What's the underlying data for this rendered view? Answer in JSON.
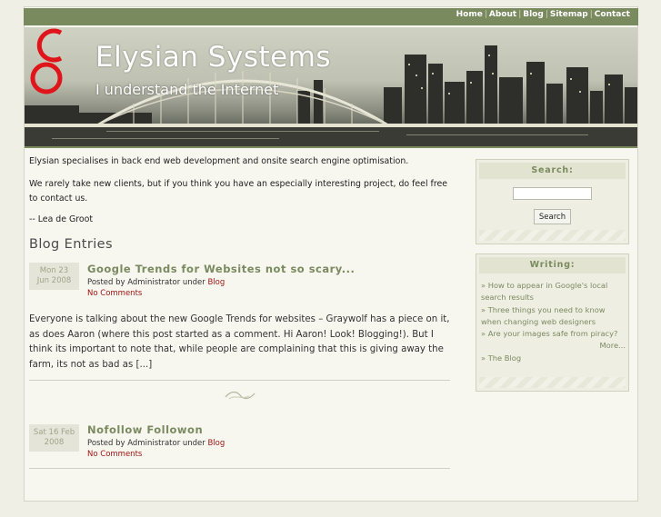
{
  "nav": {
    "items": [
      "Home",
      "About",
      "Blog",
      "Sitemap",
      "Contact"
    ],
    "separator": "|"
  },
  "header": {
    "title": "Elysian Systems",
    "tagline": "I understand the Internet"
  },
  "intro": {
    "p1": "Elysian specialises in back end web development and onsite search engine optimisation.",
    "p2": "We rarely take new clients, but if you think you have an especially interesting project, do feel free to contact us.",
    "signature": "-- Lea de Groot"
  },
  "blog": {
    "heading": "Blog Entries",
    "entries": [
      {
        "date_line1": "Mon 23",
        "date_line2": "Jun 2008",
        "title": "Google Trends for Websites not so scary...",
        "posted_by": "Posted by Administrator under ",
        "category": "Blog",
        "comments": "No Comments",
        "excerpt": "Everyone is talking about the new Google Trends for websites – Graywolf has a piece on it, as does Aaron (where this post started as a comment. Hi Aaron! Look! Blogging!). But I think its important to note that, while people are complaining that this is giving away the farm, its not as bad as [...]"
      },
      {
        "date_line1": "Sat 16 Feb",
        "date_line2": "2008",
        "title": "Nofollow Followon",
        "posted_by": "Posted by Administrator under ",
        "category": "Blog",
        "comments": "No Comments"
      }
    ]
  },
  "sidebar": {
    "search": {
      "heading": "Search:",
      "button_label": "Search",
      "value": ""
    },
    "writing": {
      "heading": "Writing:",
      "bullet": "»",
      "items": [
        "How to appear in Google's local search results",
        "Three things you need to know when changing web designers",
        "Are your images safe from piracy?"
      ],
      "more_label": "More...",
      "blog_link": "The Blog"
    }
  },
  "colors": {
    "accent_green": "#7a8a5f",
    "link_red": "#a01515",
    "logo_red": "#e0141b"
  },
  "icons": {
    "logo": "elysian-logo-icon",
    "divider": "flourish-icon"
  }
}
